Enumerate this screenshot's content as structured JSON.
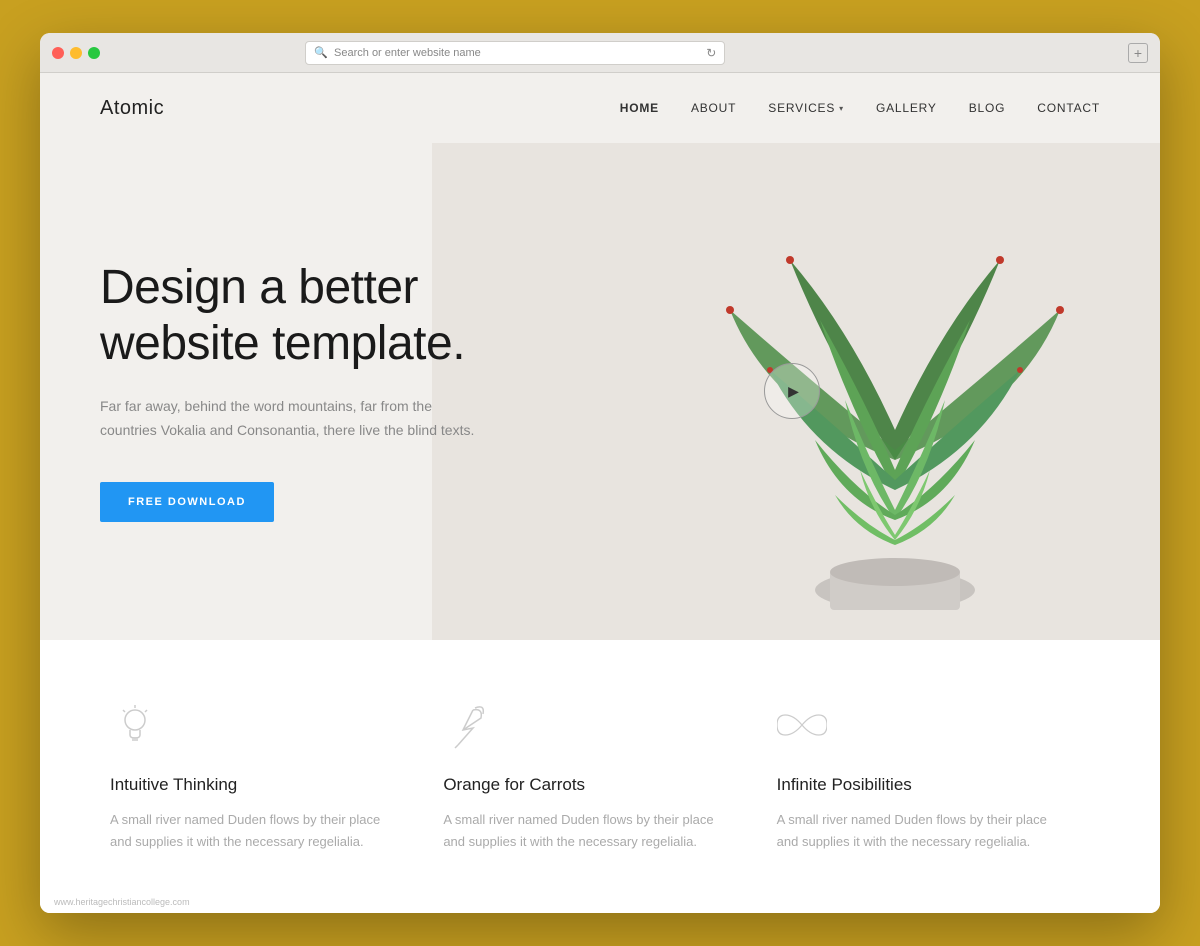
{
  "browser": {
    "address_placeholder": "Search or enter website name"
  },
  "nav": {
    "logo": "Atomic",
    "links": [
      {
        "label": "HOME",
        "active": true
      },
      {
        "label": "ABOUT",
        "active": false
      },
      {
        "label": "SERVICES",
        "active": false,
        "dropdown": true
      },
      {
        "label": "GALLERY",
        "active": false
      },
      {
        "label": "BLOG",
        "active": false
      },
      {
        "label": "CONTACT",
        "active": false
      }
    ]
  },
  "hero": {
    "title": "Design a better website template.",
    "subtitle": "Far far away, behind the word mountains, far from the countries Vokalia and Consonantia, there live the blind texts.",
    "cta_label": "FREE DOWNLOAD"
  },
  "features": [
    {
      "icon": "lightbulb-icon",
      "title": "Intuitive Thinking",
      "description": "A small river named Duden flows by their place and supplies it with the necessary regelialia."
    },
    {
      "icon": "carrot-icon",
      "title": "Orange for Carrots",
      "description": "A small river named Duden flows by their place and supplies it with the necessary regelialia."
    },
    {
      "icon": "infinity-icon",
      "title": "Infinite Posibilities",
      "description": "A small river named Duden flows by their place and supplies it with the necessary regelialia."
    }
  ],
  "footer": {
    "url": "www.heritagechristiancollege.com"
  }
}
